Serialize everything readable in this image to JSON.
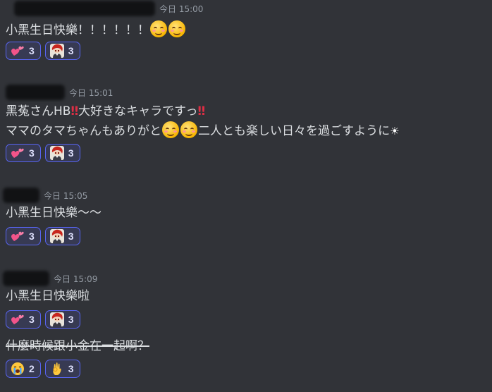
{
  "messages": [
    {
      "timestamp": "今日 15:00",
      "segments": [
        "小黑生日快樂！！！！！！"
      ],
      "reactions": [
        {
          "icon": "two-hearts-icon",
          "count": "3"
        },
        {
          "icon": "character-avatar-icon",
          "count": "3"
        }
      ]
    },
    {
      "timestamp": "今日 15:01",
      "line1_a": "黑菟さんHB",
      "line1_b": "大好きなキャラですっ",
      "line2_a": "ママのタマちゃんもありがと",
      "line2_b": "二人とも楽しい日々を過ごすように",
      "bangs": "‼",
      "sun": "☀",
      "reactions": [
        {
          "icon": "two-hearts-icon",
          "count": "3"
        },
        {
          "icon": "character-avatar-icon",
          "count": "3"
        }
      ]
    },
    {
      "timestamp": "今日 15:05",
      "text": "小黑生日快樂～～",
      "reactions": [
        {
          "icon": "two-hearts-icon",
          "count": "3"
        },
        {
          "icon": "character-avatar-icon",
          "count": "3"
        }
      ]
    },
    {
      "timestamp": "今日 15:09",
      "text": "小黑生日快樂啦",
      "reactions": [
        {
          "icon": "two-hearts-icon",
          "count": "3"
        },
        {
          "icon": "character-avatar-icon",
          "count": "3"
        }
      ],
      "strike_text": "什麼時候跟小金在一起啊？",
      "strike_reactions": [
        {
          "icon": "crying-face-icon",
          "count": "2"
        },
        {
          "icon": "ok-hand-icon",
          "count": "3"
        }
      ]
    }
  ],
  "colors": {
    "background": "#313338",
    "reaction_border": "#5865f2",
    "reaction_bg": "#373a53",
    "timestamp": "#949ba4"
  }
}
